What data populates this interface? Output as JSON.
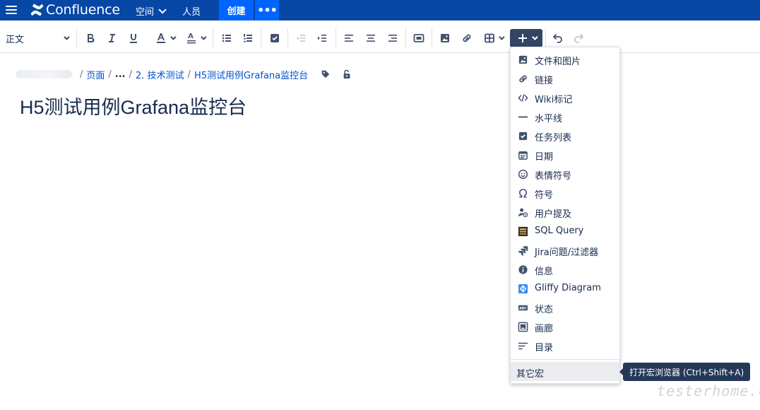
{
  "topnav": {
    "app_name": "Confluence",
    "spaces_label": "空间",
    "people_label": "人员",
    "create_label": "创建",
    "more_label": "•••"
  },
  "toolbar": {
    "paragraph_style": "正文"
  },
  "breadcrumb": {
    "items": [
      "页面",
      "...",
      "2. 技术测试",
      "H5测试用例Grafana监控台"
    ]
  },
  "page": {
    "title": "H5测试用例Grafana监控台"
  },
  "insert_menu": {
    "items": [
      {
        "label": "文件和图片",
        "icon": "image-icon"
      },
      {
        "label": "链接",
        "icon": "link-icon"
      },
      {
        "label": "Wiki标记",
        "icon": "code-icon"
      },
      {
        "label": "水平线",
        "icon": "horizontal-rule-icon"
      },
      {
        "label": "任务列表",
        "icon": "task-checkbox-icon"
      },
      {
        "label": "日期",
        "icon": "calendar-icon"
      },
      {
        "label": "表情符号",
        "icon": "emoji-icon"
      },
      {
        "label": "符号",
        "icon": "omega-icon"
      },
      {
        "label": "用户提及",
        "icon": "user-mention-icon"
      },
      {
        "label": "SQL Query",
        "icon": "database-icon"
      },
      {
        "label": "Jira问题/过滤器",
        "icon": "jira-icon"
      },
      {
        "label": "信息",
        "icon": "info-icon"
      },
      {
        "label": "Gliffy Diagram",
        "icon": "gliffy-icon"
      },
      {
        "label": "状态",
        "icon": "status-icon"
      },
      {
        "label": "画廊",
        "icon": "gallery-icon"
      },
      {
        "label": "目录",
        "icon": "toc-icon"
      }
    ],
    "other_macros": "其它宏"
  },
  "tooltip": {
    "text": "打开宏浏览器 (Ctrl+Shift+A)"
  },
  "watermark": "testerhome.com",
  "colors": {
    "nav_bg": "#0747a6",
    "create_bg": "#0065ff",
    "insert_btn_bg": "#344563",
    "tooltip_bg": "#253858",
    "link": "#0052cc"
  }
}
